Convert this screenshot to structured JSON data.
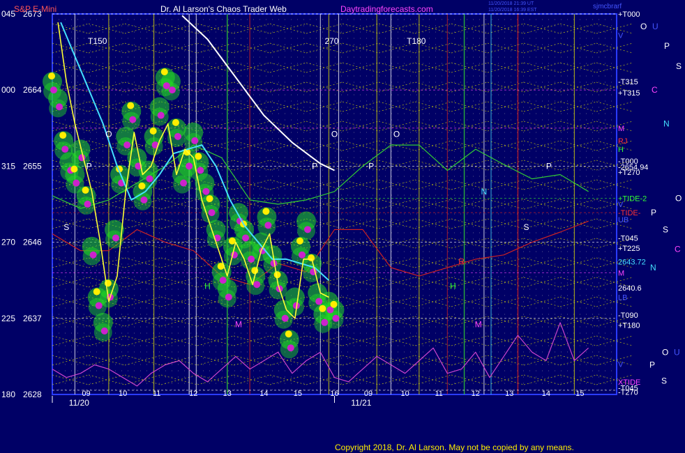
{
  "header": {
    "symbol": "S&P E-Mini",
    "title": "Dr. Al Larson's Chaos Trader Web",
    "site": "Daytradingforecasts.com",
    "stamp1": "11/20/2018 21:39 UT",
    "stamp2": "11/20/2018 16:39 EST",
    "user": "sjmcbrarf"
  },
  "footer": {
    "copyright": "Copyright 2018, Dr. Al Larson. May not be copied by any means."
  },
  "colors": {
    "background": "#000066",
    "frame": "#2a3cff",
    "grid_yellow": "#e6e600",
    "white_line": "#ffffff",
    "cyan_line": "#44e0ff",
    "yellow_line": "#ffff33",
    "green_tide": "#33cc33",
    "red_tide": "#cc2222",
    "magenta_xtide": "#cc44cc",
    "bubble_green": "#22dd22",
    "dot_magenta": "#cc22cc",
    "dot_yellow": "#ffee00"
  },
  "chart_data": {
    "type": "line",
    "title": "S&P E-Mini",
    "ylim": [
      2628,
      2673
    ],
    "y_ticks": [
      {
        "angle": "045",
        "price": "2673",
        "value": 2673
      },
      {
        "angle": "000",
        "price": "2664",
        "value": 2664
      },
      {
        "angle": "315",
        "price": "2655",
        "value": 2655
      },
      {
        "angle": "270",
        "price": "2646",
        "value": 2646
      },
      {
        "angle": "225",
        "price": "2637",
        "value": 2637
      },
      {
        "angle": "180",
        "price": "2628",
        "value": 2628
      }
    ],
    "x_hour_labels": [
      {
        "label": "09",
        "t": 1.2
      },
      {
        "label": "10",
        "t": 2.5
      },
      {
        "label": "11",
        "t": 3.7
      },
      {
        "label": "12",
        "t": 5.0
      },
      {
        "label": "13",
        "t": 6.2
      },
      {
        "label": "14",
        "t": 7.5
      },
      {
        "label": "15",
        "t": 8.7
      },
      {
        "label": "16",
        "t": 10.0
      },
      {
        "label": "09",
        "t": 11.2
      },
      {
        "label": "10",
        "t": 12.5
      },
      {
        "label": "11",
        "t": 13.7
      },
      {
        "label": "12",
        "t": 15.0
      },
      {
        "label": "13",
        "t": 16.2
      },
      {
        "label": "14",
        "t": 17.5
      },
      {
        "label": "15",
        "t": 18.7
      }
    ],
    "x_date_labels": [
      {
        "label": "11/20",
        "t": 0.8
      },
      {
        "label": "11/21",
        "t": 10.8
      }
    ],
    "right_labels": [
      {
        "text": "+T000",
        "value": 2673,
        "color": "#ffffff"
      },
      {
        "text": "V",
        "value": 2670.5,
        "color": "#4455ff"
      },
      {
        "text": "-T315",
        "value": 2665,
        "color": "#ffffff"
      },
      {
        "text": "+T315",
        "value": 2663.7,
        "color": "#ffffff"
      },
      {
        "text": "M",
        "value": 2659.5,
        "color": "#ff44ff"
      },
      {
        "text": "RJ",
        "value": 2658,
        "color": "#ff3333"
      },
      {
        "text": "H",
        "value": 2657,
        "color": "#33ff33"
      },
      {
        "text": "-T000",
        "value": 2655.6,
        "color": "#ffffff"
      },
      {
        "text": "-2654.94",
        "value": 2654.9,
        "color": "#ffffff"
      },
      {
        "text": "+T270",
        "value": 2654.3,
        "color": "#ffffff"
      },
      {
        "text": "+TIDE-2",
        "value": 2651.2,
        "color": "#33ff33"
      },
      {
        "text": "V",
        "value": 2650.5,
        "color": "#4455ff"
      },
      {
        "text": "-TIDE-",
        "value": 2649.5,
        "color": "#ff3333"
      },
      {
        "text": "UB",
        "value": 2648.7,
        "color": "#4455ff"
      },
      {
        "text": "-T045",
        "value": 2646.5,
        "color": "#ffffff"
      },
      {
        "text": "+T225",
        "value": 2645.3,
        "color": "#ffffff"
      },
      {
        "text": "2643.72",
        "value": 2643.7,
        "color": "#44e0ff"
      },
      {
        "text": "M",
        "value": 2642.4,
        "color": "#ff44ff"
      },
      {
        "text": "2640.6",
        "value": 2640.6,
        "color": "#ffffff"
      },
      {
        "text": "LB",
        "value": 2639.5,
        "color": "#4455ff"
      },
      {
        "text": "-T090",
        "value": 2637.4,
        "color": "#ffffff"
      },
      {
        "text": "+T180",
        "value": 2636.2,
        "color": "#ffffff"
      },
      {
        "text": "V",
        "value": 2631.6,
        "color": "#4455ff"
      },
      {
        "text": "XTIDE",
        "value": 2629.5,
        "color": "#ff44ff"
      },
      {
        "text": "-T045",
        "value": 2628.8,
        "color": "#ffffff"
      },
      {
        "text": "-T270",
        "value": 2628.3,
        "color": "#ffffff"
      }
    ],
    "planet_labels": [
      {
        "text": "O",
        "value": 2671.5,
        "color": "#ffffff"
      },
      {
        "text": "U",
        "value": 2671.5,
        "color": "#4455ff"
      },
      {
        "text": "P",
        "value": 2669.2,
        "color": "#ffffff"
      },
      {
        "text": "S",
        "value": 2666.8,
        "color": "#ffffff"
      },
      {
        "text": "C",
        "value": 2664,
        "color": "#ff44ff"
      },
      {
        "text": "N",
        "value": 2660,
        "color": "#44e0ff"
      },
      {
        "text": "O",
        "value": 2651.2,
        "color": "#ffffff"
      },
      {
        "text": "P",
        "value": 2649.5,
        "color": "#ffffff"
      },
      {
        "text": "S",
        "value": 2647.5,
        "color": "#ffffff"
      },
      {
        "text": "C",
        "value": 2645.2,
        "color": "#ff44ff"
      },
      {
        "text": "N",
        "value": 2643,
        "color": "#44e0ff"
      },
      {
        "text": "O",
        "value": 2633,
        "color": "#ffffff"
      },
      {
        "text": "U",
        "value": 2633,
        "color": "#4455ff"
      },
      {
        "text": "P",
        "value": 2631.5,
        "color": "#ffffff"
      },
      {
        "text": "S",
        "value": 2629.6,
        "color": "#ffffff"
      }
    ],
    "in_chart_labels": [
      {
        "text": "T150",
        "t": 1.6,
        "value": 2669.8,
        "color": "#ffffff"
      },
      {
        "text": "270",
        "t": 9.9,
        "value": 2669.8,
        "color": "#ffffff"
      },
      {
        "text": "T180",
        "t": 12.9,
        "value": 2669.8,
        "color": "#ffffff"
      },
      {
        "text": "O",
        "t": 2.0,
        "value": 2658.8,
        "color": "#ffffff"
      },
      {
        "text": "O",
        "t": 10.0,
        "value": 2658.8,
        "color": "#ffffff"
      },
      {
        "text": "O",
        "t": 12.2,
        "value": 2658.8,
        "color": "#ffffff"
      },
      {
        "text": "P",
        "t": 1.3,
        "value": 2655,
        "color": "#ffffff"
      },
      {
        "text": "P",
        "t": 9.3,
        "value": 2655,
        "color": "#ffffff"
      },
      {
        "text": "P",
        "t": 11.3,
        "value": 2655,
        "color": "#ffffff"
      },
      {
        "text": "P",
        "t": 17.6,
        "value": 2655,
        "color": "#ffffff"
      },
      {
        "text": "N",
        "t": 15.3,
        "value": 2652,
        "color": "#44e0ff"
      },
      {
        "text": "S",
        "t": 0.5,
        "value": 2647.8,
        "color": "#ffffff"
      },
      {
        "text": "S",
        "t": 16.8,
        "value": 2647.8,
        "color": "#ffffff"
      },
      {
        "text": "H",
        "t": 5.5,
        "value": 2640.8,
        "color": "#33ff33"
      },
      {
        "text": "H",
        "t": 14.2,
        "value": 2640.8,
        "color": "#33ff33"
      },
      {
        "text": "R",
        "t": 14.5,
        "value": 2643.7,
        "color": "#ff3333"
      },
      {
        "text": "M",
        "t": 6.6,
        "value": 2636.3,
        "color": "#ff44ff"
      },
      {
        "text": "M",
        "t": 15.1,
        "value": 2636.3,
        "color": "#ff44ff"
      }
    ],
    "series": [
      {
        "role": "price_bubbles",
        "t": [
          0,
          0.2,
          0.4,
          0.6,
          0.8,
          1.0,
          1.2,
          1.4,
          1.6,
          1.8,
          2.0,
          2.2,
          2.4,
          2.6,
          2.8,
          3.0,
          3.2,
          3.4,
          3.6,
          3.8,
          4.0,
          4.2,
          4.4,
          4.6,
          4.8,
          5.0,
          5.2,
          5.4,
          5.6,
          5.8,
          6.0,
          6.2,
          6.4,
          6.6,
          6.8,
          7.0,
          7.2,
          7.4,
          7.6,
          7.8,
          8.0,
          8.2,
          8.4,
          8.6,
          8.8,
          9.0,
          9.2,
          9.4,
          9.6,
          9.8,
          10.0
        ],
        "values": [
          2664.5,
          2662.5,
          2657.5,
          2655,
          2653.5,
          2656.5,
          2651,
          2645,
          2639,
          2636,
          2640,
          2647,
          2653.5,
          2658,
          2661,
          2655.5,
          2651.5,
          2654,
          2658,
          2661.5,
          2665,
          2664.5,
          2659,
          2653.5,
          2655.5,
          2658.5,
          2655,
          2652.5,
          2650,
          2647,
          2642,
          2640,
          2645,
          2649,
          2647,
          2644.5,
          2641.5,
          2645.5,
          2648.5,
          2644,
          2641,
          2637.5,
          2634,
          2639,
          2645,
          2648,
          2643,
          2639.5,
          2637,
          2638.5,
          2637.5
        ]
      },
      {
        "role": "yellow_price",
        "t": [
          0.2,
          0.5,
          0.8,
          1.1,
          1.4,
          1.7,
          2.0,
          2.3,
          2.6,
          2.9,
          3.2,
          3.5,
          3.8,
          4.1,
          4.4,
          4.7,
          5.0,
          5.3,
          5.6,
          5.9,
          6.2,
          6.5,
          6.8,
          7.1,
          7.4,
          7.7,
          8.0,
          8.3,
          8.6,
          8.9,
          9.2,
          9.5,
          9.8
        ],
        "values": [
          2672,
          2665,
          2660,
          2656,
          2652,
          2646,
          2639,
          2642,
          2652,
          2659,
          2654,
          2655,
          2658,
          2660,
          2654,
          2657,
          2656,
          2651,
          2648,
          2645,
          2642,
          2646,
          2644,
          2641,
          2645,
          2647,
          2641,
          2638,
          2637,
          2644,
          2644,
          2640,
          2639.5
        ]
      },
      {
        "role": "cyan_average",
        "t": [
          0.3,
          0.8,
          1.3,
          1.8,
          2.3,
          2.8,
          3.3,
          3.8,
          4.3,
          4.8,
          5.3,
          5.8,
          6.3,
          6.8,
          7.3,
          7.8,
          8.3,
          8.8,
          9.3,
          9.8
        ],
        "values": [
          2672,
          2668,
          2664,
          2660,
          2655,
          2651,
          2652,
          2654,
          2656.5,
          2657,
          2657.5,
          2655,
          2651,
          2648,
          2646,
          2644,
          2644,
          2643.5,
          2643,
          2641.5
        ]
      },
      {
        "role": "white_trend",
        "t": [
          4.6,
          5.5,
          6.5,
          7.5,
          8.5,
          9.5,
          10.0
        ],
        "values": [
          2672.8,
          2670,
          2665.5,
          2661,
          2657.8,
          2655.3,
          2654.5
        ]
      },
      {
        "role": "green_tide",
        "t": [
          0,
          1,
          2,
          3,
          4,
          5,
          6,
          7,
          8,
          9,
          10,
          11,
          12,
          13,
          14,
          15,
          16,
          17,
          18,
          19
        ],
        "values": [
          2651.5,
          2650,
          2651,
          2653,
          2655,
          2657.5,
          2656,
          2651,
          2650.5,
          2651,
          2652,
          2655,
          2657.5,
          2657.5,
          2654.5,
          2657,
          2655.2,
          2653.5,
          2654,
          2652
        ]
      },
      {
        "role": "red_tide",
        "t": [
          0,
          1,
          2,
          3,
          4,
          5,
          6,
          7,
          8,
          9,
          10,
          11,
          12,
          13,
          14,
          15,
          16,
          17,
          18,
          19
        ],
        "values": [
          2647,
          2645,
          2645,
          2647.5,
          2646,
          2645,
          2642,
          2641,
          2643.5,
          2642.5,
          2647.5,
          2647.5,
          2643,
          2642,
          2643,
          2644,
          2644.5,
          2646,
          2647.2,
          2648.5
        ]
      },
      {
        "role": "xtide",
        "t": [
          0,
          0.5,
          1,
          1.5,
          2,
          2.5,
          3,
          3.5,
          4,
          4.5,
          5,
          5.5,
          6,
          6.5,
          7,
          7.5,
          8,
          8.5,
          9,
          9.5,
          10,
          10.5,
          11,
          11.5,
          12,
          12.5,
          13,
          13.5,
          14,
          14.5,
          15,
          15.5,
          16,
          16.5,
          17,
          17.5,
          18,
          18.5,
          19
        ],
        "values": [
          2631,
          2630,
          2630.5,
          2631.5,
          2631,
          2630,
          2629,
          2630.5,
          2631.5,
          2632,
          2630.5,
          2629.5,
          2631,
          2632.5,
          2631,
          2632,
          2633,
          2630.5,
          2632,
          2633,
          2630,
          2629.5,
          2631,
          2632.5,
          2631.5,
          2630.5,
          2632,
          2633.5,
          2630.5,
          2631,
          2633,
          2630,
          2632.5,
          2635,
          2633,
          2632,
          2636.5,
          2632,
          2633.5
        ]
      }
    ]
  }
}
